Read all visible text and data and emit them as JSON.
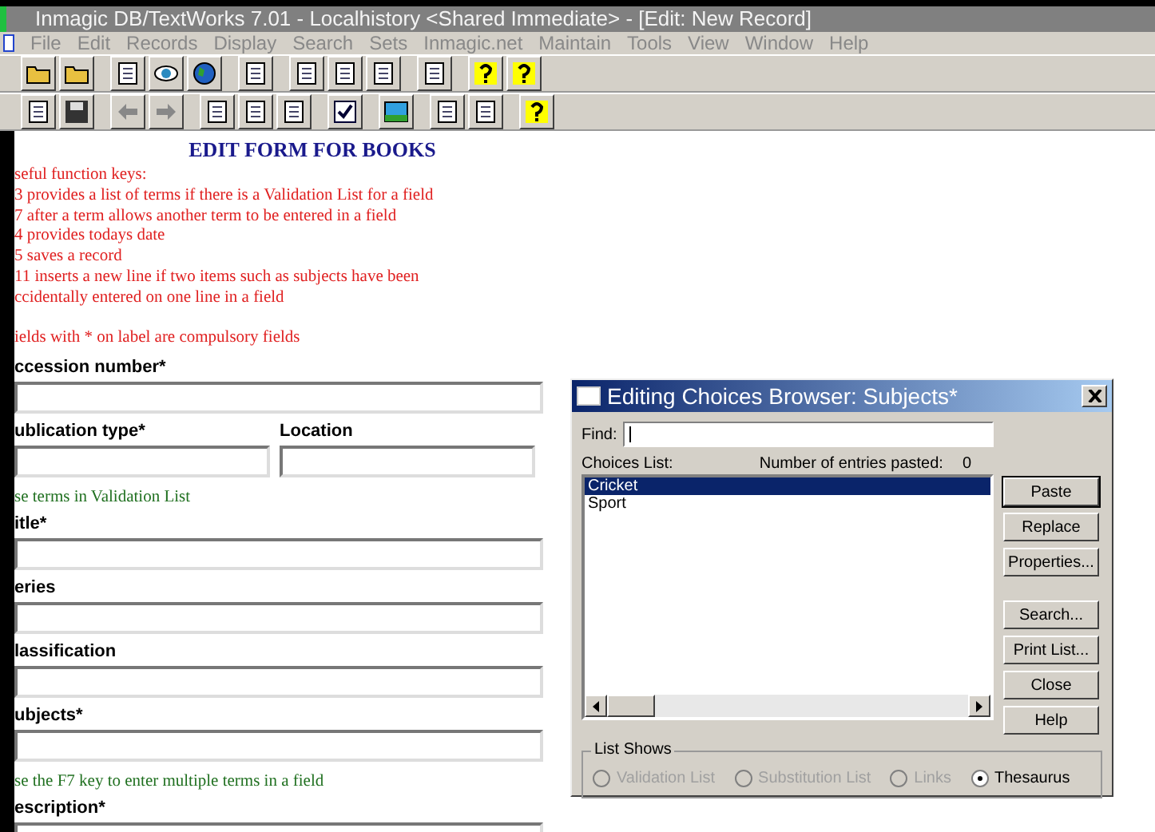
{
  "window": {
    "title": "Inmagic DB/TextWorks 7.01 - Localhistory <Shared Immediate> - [Edit: New Record]"
  },
  "menu": [
    "File",
    "Edit",
    "Records",
    "Display",
    "Search",
    "Sets",
    "Inmagic.net",
    "Maintain",
    "Tools",
    "View",
    "Window",
    "Help"
  ],
  "form": {
    "heading": "EDIT FORM FOR BOOKS",
    "notes": [
      "seful function keys:",
      "3 provides a list of terms if there is a Validation List for a field",
      "7 after a term allows another term to be entered in a field",
      "4 provides todays date",
      "5 saves a record",
      "11 inserts a new line if two items such as subjects have been",
      "ccidentally entered on one line in a field"
    ],
    "compulsory_note": "ields with * on label are compulsory fields",
    "items": [
      {
        "kind": "field",
        "label": "ccession number*"
      },
      {
        "kind": "pair",
        "fields": [
          {
            "label": "ublication type*"
          },
          {
            "label": "Location"
          }
        ]
      },
      {
        "kind": "hint",
        "text": "se terms in Validation List"
      },
      {
        "kind": "field",
        "label": "itle*"
      },
      {
        "kind": "field",
        "label": "eries"
      },
      {
        "kind": "field",
        "label": "lassification"
      },
      {
        "kind": "field",
        "label": "ubjects*"
      },
      {
        "kind": "hint",
        "text": "se the F7 key to enter multiple terms in a field"
      },
      {
        "kind": "field",
        "label": "escription*"
      }
    ]
  },
  "dialog": {
    "title": "Editing Choices Browser: Subjects*",
    "find_label": "Find:",
    "choices_label": "Choices List:",
    "pasted_label": "Number of entries pasted:",
    "pasted_count": "0",
    "choices": [
      {
        "text": "Cricket",
        "selected": true
      },
      {
        "text": "Sport",
        "selected": false
      }
    ],
    "buttons": [
      {
        "label": "Paste",
        "default": true
      },
      {
        "label": "Replace",
        "default": false
      },
      {
        "label": "Properties...",
        "default": false
      },
      {
        "label": "Search...",
        "default": false
      },
      {
        "label": "Print List...",
        "default": false
      },
      {
        "label": "Close",
        "default": false
      },
      {
        "label": "Help",
        "default": false
      }
    ],
    "group_label": "List Shows",
    "options": [
      {
        "label": "Validation List",
        "selected": false,
        "disabled": true
      },
      {
        "label": "Substitution List",
        "selected": false,
        "disabled": true
      },
      {
        "label": "Links",
        "selected": false,
        "disabled": true
      },
      {
        "label": "Thesaurus",
        "selected": true,
        "disabled": false
      }
    ]
  }
}
